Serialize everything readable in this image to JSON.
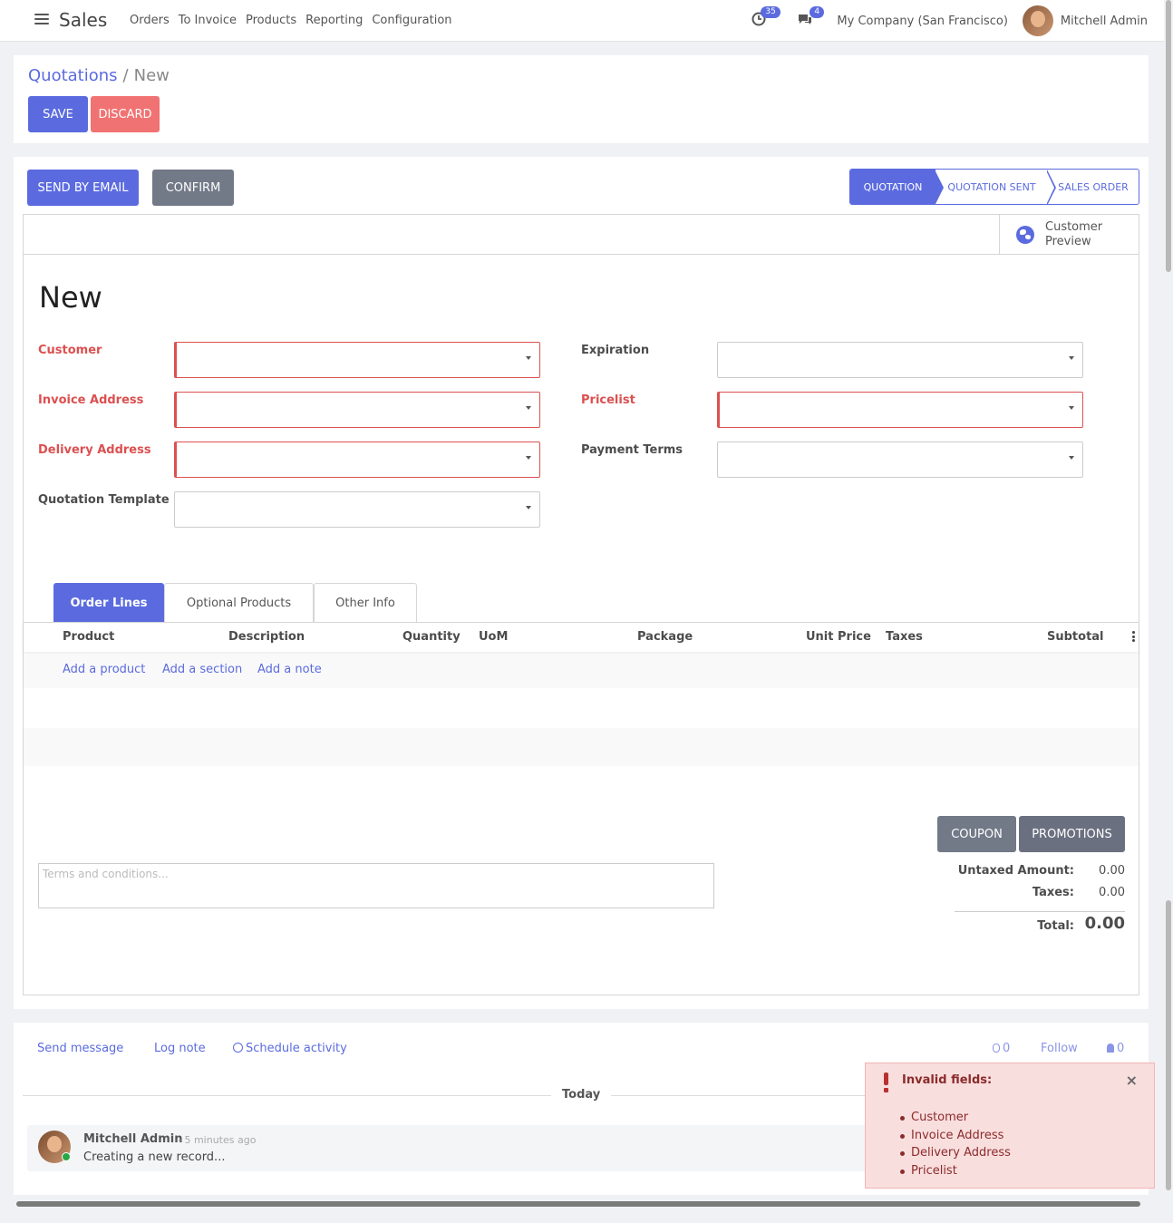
{
  "nav": {
    "app": "Sales",
    "menus": [
      "Orders",
      "To Invoice",
      "Products",
      "Reporting",
      "Configuration"
    ],
    "activity_count": "35",
    "message_count": "4",
    "company": "My Company (San Francisco)",
    "user": "Mitchell Admin"
  },
  "breadcrumb": {
    "parent": "Quotations",
    "sep": "/",
    "current": "New"
  },
  "buttons": {
    "save": "SAVE",
    "discard": "DISCARD",
    "send_email": "SEND BY EMAIL",
    "confirm": "CONFIRM",
    "coupon": "COUPON",
    "promotions": "PROMOTIONS"
  },
  "status": [
    "QUOTATION",
    "QUOTATION SENT",
    "SALES ORDER"
  ],
  "preview": {
    "label": "Customer Preview"
  },
  "form": {
    "title": "New",
    "left_fields": [
      "Customer",
      "Invoice Address",
      "Delivery Address",
      "Quotation Template"
    ],
    "right_fields": [
      "Expiration",
      "Pricelist",
      "Payment Terms"
    ]
  },
  "tabs": [
    "Order Lines",
    "Optional Products",
    "Other Info"
  ],
  "table": {
    "headers": [
      "Product",
      "Description",
      "Quantity",
      "UoM",
      "Package",
      "Unit Price",
      "Taxes",
      "Subtotal"
    ],
    "add_links": [
      "Add a product",
      "Add a section",
      "Add a note"
    ]
  },
  "note_placeholder": "Terms and conditions...",
  "totals": {
    "untaxed_label": "Untaxed Amount:",
    "untaxed": "0.00",
    "taxes_label": "Taxes:",
    "taxes": "0.00",
    "total_label": "Total:",
    "total": "0.00"
  },
  "chatter": {
    "send": "Send message",
    "log": "Log note",
    "schedule": "Schedule activity",
    "attachments": "0",
    "follow": "Follow",
    "followers": "0",
    "today": "Today",
    "author": "Mitchell Admin",
    "time": "- 5 minutes ago",
    "body": "Creating a new record..."
  },
  "notification": {
    "title": "Invalid fields:",
    "close": "×",
    "items": [
      "Customer",
      "Invoice Address",
      "Delivery Address",
      "Pricelist"
    ]
  },
  "colors": {
    "primary": "#5b6bdf",
    "danger": "#f17272",
    "secondary": "#727987"
  }
}
